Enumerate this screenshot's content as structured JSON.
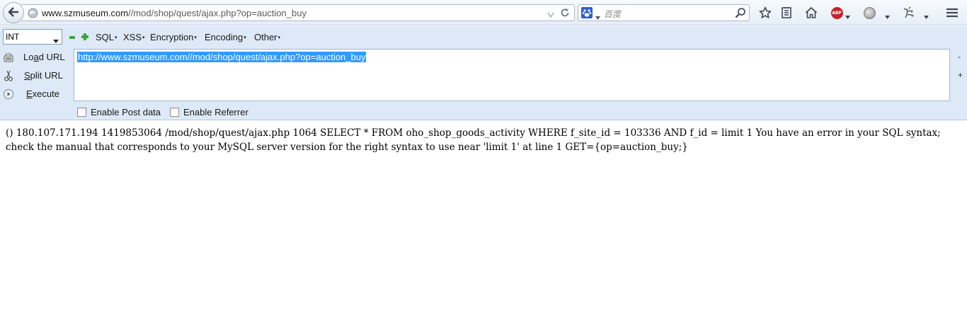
{
  "navbar": {
    "url_host": "www.szmuseum.com",
    "url_path": "//mod/shop/quest/ajax.php?op=auction_buy",
    "search_placeholder": "百度",
    "icons": [
      "back-arrow-icon",
      "globe-icon",
      "dropdown-arrow-icon",
      "reload-icon",
      "baidu-paw-icon",
      "magnifier-icon",
      "star-icon",
      "reading-list-icon",
      "home-icon",
      "adblock-plus-icon",
      "globe-addon-icon",
      "flower-addon-icon",
      "hamburger-menu-icon"
    ]
  },
  "hackbar": {
    "type_select": {
      "value": "INT"
    },
    "menus": {
      "sql": "SQL",
      "xss": "XSS",
      "encryption": "Encryption",
      "encoding": "Encoding",
      "other": "Other"
    },
    "actions": {
      "load_url_pre": "Lo",
      "load_url_u": "a",
      "load_url_post": "d URL",
      "split_url_u": "S",
      "split_url_post": "plit URL",
      "execute_u": "E",
      "execute_post": "xecute"
    },
    "textarea_value": "http://www.szmuseum.com//mod/shop/quest/ajax.php?op=auction_buy",
    "side_minus": "-",
    "side_plus": "+",
    "enable_post_label": "Enable Post data",
    "enable_referrer_label": "Enable Referrer"
  },
  "page": {
    "body_text": "() 180.107.171.194 1419853064 /mod/shop/quest/ajax.php 1064 SELECT * FROM oho_shop_goods_activity WHERE f_site_id = 103336 AND f_id = limit 1 You have an error in your SQL syntax; check the manual that corresponds to your MySQL server version for the right syntax to use near 'limit 1' at line 1 GET={op=auction_buy;}"
  },
  "colors": {
    "hackbar_bg": "#dde9f6",
    "selection": "#3399ff",
    "green_buttons": "#3aa53a",
    "abp_red": "#c8202a"
  }
}
